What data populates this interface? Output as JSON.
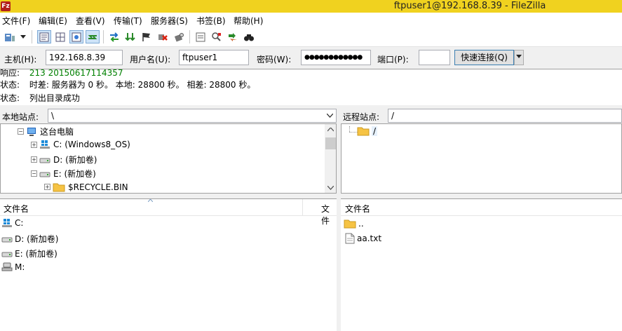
{
  "window": {
    "title": "ftpuser1@192.168.8.39 - FileZilla",
    "app_icon": "filezilla-icon",
    "accent": "#f0d21f"
  },
  "menu": {
    "items": [
      "文件(F)",
      "编辑(E)",
      "查看(V)",
      "传输(T)",
      "服务器(S)",
      "书签(B)",
      "帮助(H)"
    ]
  },
  "toolbar": {
    "icons": [
      "site-manager-icon",
      "dropdown-arrow-icon",
      "toggle-log-icon",
      "toggle-local-tree-icon",
      "toggle-remote-tree-icon",
      "toggle-queue-icon",
      "refresh-icon",
      "process-queue-icon",
      "cancel-icon",
      "disconnect-icon",
      "reconnect-icon",
      "filter-icon",
      "compare-icon",
      "sync-browse-icon",
      "search-icon"
    ]
  },
  "quickconnect": {
    "host_label": "主机(H):",
    "host_value": "192.168.8.39",
    "user_label": "用户名(U):",
    "user_value": "ftpuser1",
    "pass_label": "密码(W):",
    "pass_value": "●●●●●●●●●●●●",
    "port_label": "端口(P):",
    "port_value": "",
    "button_label": "快速连接(Q)"
  },
  "log": {
    "lines": [
      {
        "prefix": "响应:",
        "text": "213 20150617114357",
        "color": "#008000"
      },
      {
        "prefix": "状态:",
        "text": "时差: 服务器为 0 秒。 本地: 28800 秒。 相差: 28800 秒。",
        "color": "#000000"
      },
      {
        "prefix": "状态:",
        "text": "列出目录成功",
        "color": "#000000"
      }
    ]
  },
  "local": {
    "site_label": "本地站点:",
    "site_path": "\\",
    "tree": [
      {
        "label": "这台电脑",
        "icon": "computer-icon",
        "expander": "⊟"
      },
      {
        "label": "C: (Windows8_OS)",
        "icon": "windows-drive-icon",
        "expander": "⊞"
      },
      {
        "label": "D: (新加卷)",
        "icon": "drive-icon",
        "expander": "⊞"
      },
      {
        "label": "E: (新加卷)",
        "icon": "drive-icon",
        "expander": "⊟"
      },
      {
        "label": "$RECYCLE.BIN",
        "icon": "folder-icon",
        "expander": "⊞"
      }
    ],
    "list_header": {
      "name": "文件名",
      "next": "文件"
    },
    "files": [
      {
        "name": "C:",
        "icon": "windows-drive-icon"
      },
      {
        "name": "D: (新加卷)",
        "icon": "drive-icon"
      },
      {
        "name": "E: (新加卷)",
        "icon": "drive-icon"
      },
      {
        "name": "M:",
        "icon": "network-drive-icon"
      }
    ]
  },
  "remote": {
    "site_label": "远程站点:",
    "site_path": "/",
    "tree": [
      {
        "label": "/",
        "icon": "folder-icon"
      }
    ],
    "list_header": {
      "name": "文件名"
    },
    "files": [
      {
        "name": "..",
        "icon": "folder-icon"
      },
      {
        "name": "aa.txt",
        "icon": "text-file-icon"
      }
    ]
  }
}
